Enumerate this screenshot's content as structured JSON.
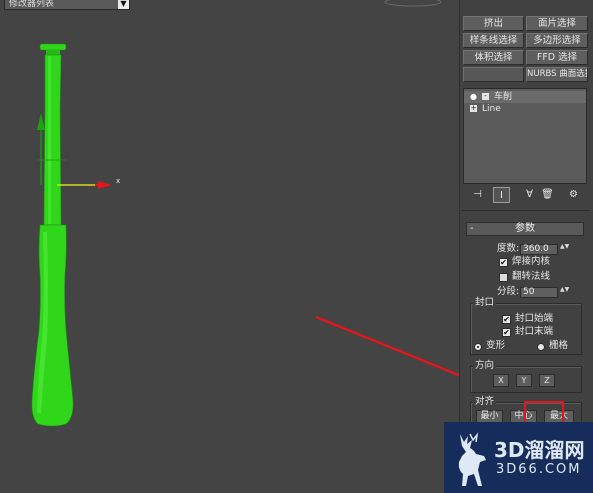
{
  "viewport": {
    "axis_x_label": "x"
  },
  "panel": {
    "modifier_list": "修改器列表",
    "modifier_list_arrow": "▼",
    "buttons": {
      "extrude": "挤出",
      "face_select": "面片选择",
      "spline_select": "样条线选择",
      "poly_select": "多边形选择",
      "volume_select": "体积选择",
      "ffd_select": "FFD 选择",
      "nurbs_surface_select": "NURBS 曲面选择"
    },
    "stack": {
      "items": [
        {
          "label": "车削",
          "toggle": "-"
        },
        {
          "label": "Line",
          "toggle": "+"
        }
      ],
      "bulb": "●"
    },
    "toolbar": {
      "pin": "⊣",
      "show_end": "I",
      "unique": "∀",
      "remove": "🗑",
      "configure": "⚙"
    },
    "params": {
      "title": "参数",
      "collapse": "-",
      "degrees_label": "度数:",
      "degrees_value": "360.0",
      "weld_core_label": "焊接内核",
      "weld_core_checked": true,
      "flip_normals_label": "翻转法线",
      "flip_normals_checked": false,
      "segments_label": "分段:",
      "segments_value": "50",
      "spin_arrows": "▲▼",
      "capping": {
        "title": "封口",
        "cap_start_label": "封口始端",
        "cap_start_checked": true,
        "cap_end_label": "封口末端",
        "cap_end_checked": true,
        "morph_label": "变形",
        "grid_label": "栅格",
        "selected": "morph"
      },
      "direction": {
        "title": "方向",
        "x": "X",
        "y": "Y",
        "z": "Z"
      },
      "align": {
        "title": "对齐",
        "min": "最小",
        "center": "中心",
        "max": "最大"
      }
    }
  },
  "watermark": {
    "title": "3D溜溜网",
    "url": "3D66.COM"
  },
  "colors": {
    "model": "#2fd61a",
    "annotation": "#e4151c",
    "viewport_bg": "#444444",
    "panel_bg": "#414141"
  }
}
